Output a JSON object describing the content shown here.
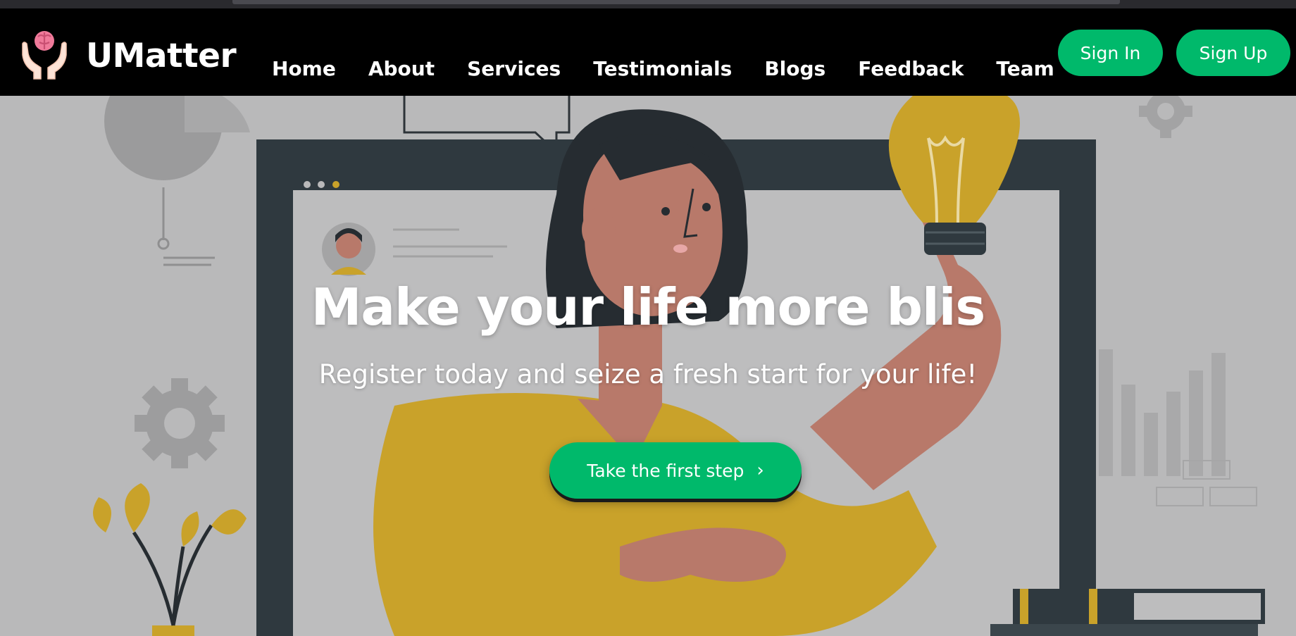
{
  "brand": {
    "name": "UMatter",
    "logo_icon": "brain-in-hands-icon"
  },
  "nav": {
    "items": [
      {
        "label": "Home"
      },
      {
        "label": "About"
      },
      {
        "label": "Services"
      },
      {
        "label": "Testimonials"
      },
      {
        "label": "Blogs"
      },
      {
        "label": "Feedback"
      },
      {
        "label": "Team"
      }
    ],
    "sign_in_label": "Sign In",
    "sign_up_label": "Sign Up"
  },
  "hero": {
    "headline": "Make your life more blis",
    "subheadline": "Register today and seize a fresh start for your life!",
    "cta_label": "Take the first step",
    "cta_icon": "chevron-right-icon"
  },
  "colors": {
    "navbar_bg": "#000000",
    "accent_green": "#00b96b",
    "hero_overlay": "#b9b9ba",
    "illustration_yellow": "#c9a22a",
    "illustration_skin": "#b8796a"
  }
}
